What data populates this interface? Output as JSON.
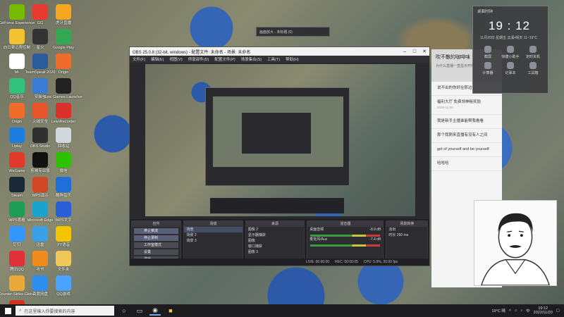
{
  "desktop_icons": [
    {
      "label": "GeForce Experience",
      "color": "#76b900"
    },
    {
      "label": "GG",
      "color": "#e83a2e"
    },
    {
      "label": "虎牙直播",
      "color": "#f5a623"
    },
    {
      "label": "向日葵远程控制",
      "color": "#f2c230"
    },
    {
      "label": "星火",
      "color": "#333333"
    },
    {
      "label": "Google Play",
      "color": "#34a853"
    },
    {
      "label": "Mr",
      "color": "#ffffff"
    },
    {
      "label": "TeamSpeak 2020",
      "color": "#2b5b9c"
    },
    {
      "label": "Origin",
      "color": "#f06c2a"
    },
    {
      "label": "QQ音乐",
      "color": "#31c27c"
    },
    {
      "label": "安装包",
      "color": "#3a7bd5"
    },
    {
      "label": "Epic Games Launcher",
      "color": "#222222"
    },
    {
      "label": "Origin",
      "color": "#f06c2a"
    },
    {
      "label": "火绒安全",
      "color": "#e8552a"
    },
    {
      "label": "LeanRecorder",
      "color": "#d9302a"
    },
    {
      "label": "Uplay",
      "color": "#1f7ce0"
    },
    {
      "label": "OBS Studio",
      "color": "#303030"
    },
    {
      "label": "回收站",
      "color": "#cfd8dc"
    },
    {
      "label": "WeGame",
      "color": "#e03b2a"
    },
    {
      "label": "剪映专业版",
      "color": "#111111"
    },
    {
      "label": "微信",
      "color": "#2dc100"
    },
    {
      "label": "Steam",
      "color": "#1b2838"
    },
    {
      "label": "WPS演示",
      "color": "#d24726"
    },
    {
      "label": "酷狗音乐",
      "color": "#1e6fd9"
    },
    {
      "label": "WPS表格",
      "color": "#1f9d55"
    },
    {
      "label": "Microsoft Edge",
      "color": "#1aa3cf"
    },
    {
      "label": "WPS文字",
      "color": "#2b5fd9"
    },
    {
      "label": "钉钉",
      "color": "#3296fa"
    },
    {
      "label": "迅雷",
      "color": "#3aa0e8"
    },
    {
      "label": "YY语音",
      "color": "#f5c400"
    },
    {
      "label": "腾讯QQ",
      "color": "#e0303a"
    },
    {
      "label": "听书",
      "color": "#f08c1e"
    },
    {
      "label": "文件夹",
      "color": "#f2c75a"
    },
    {
      "label": "Counter-Strike Global",
      "color": "#e8a93a"
    },
    {
      "label": "百度网盘",
      "color": "#2f8ff0"
    },
    {
      "label": "QQ游戏",
      "color": "#4aa3ff"
    },
    {
      "label": "网易云音乐",
      "color": "#d4301e"
    }
  ],
  "obs": {
    "title": "OBS 25.0.8 (32-bit, windows) - 配置文件: 未命名 - 场景: 未命名",
    "menu": [
      "文件(F)",
      "编辑(E)",
      "视图(V)",
      "停靠部件(D)",
      "配置文件(P)",
      "场景集合(S)",
      "工具(T)",
      "帮助(H)"
    ],
    "docks": {
      "controls_title": "控件",
      "controls": [
        "停止推流",
        "停止录制",
        "工作室模式",
        "设置",
        "退出"
      ],
      "scenes_title": "场景",
      "scenes": [
        "场景",
        "场景 2",
        "场景 3"
      ],
      "sources_title": "来源",
      "sources": [
        "图像 2",
        "显示器捕获",
        "图像",
        "窗口捕获",
        "图像 3"
      ],
      "mixer_title": "混音器",
      "mixer": [
        {
          "name": "桌面音频",
          "db": "-8.9 dB"
        },
        {
          "name": "麦克风/Aux",
          "db": "-7.4 dB"
        }
      ],
      "transition_title": "场景转换",
      "transition_type": "淡出",
      "duration_label": "时长",
      "duration_value": "250 ms"
    },
    "status": {
      "live": "LIVE: 00:00:00",
      "rec": "REC: 00:00:05",
      "cpu": "CPU: 5.9%, 30.00 fps"
    }
  },
  "small_window": {
    "label": "画面放大 - 未标题 (0)"
  },
  "clock_panel": {
    "title": "桌面时钟",
    "time": "19 : 12",
    "date": "11月20日  星期五        云溪•晴天 11~19°C",
    "tiles": [
      "截屏",
      "快捷小助手",
      "定时关机",
      "计算器",
      "记事本",
      "工具箱"
    ]
  },
  "chat": {
    "header": "吹不散的咖啡味",
    "subheader": "为什么直播一直显示开播",
    "messages": [
      {
        "text": "说不出的你好在那边",
        "meta": ""
      },
      {
        "text": "福利大厅 免费领神秘奖励",
        "meta": "2020-11-20"
      },
      {
        "text": "我是新手主播谁能帮我看看",
        "meta": ""
      },
      {
        "text": "那个我刚来直播有没有人之间",
        "meta": ""
      },
      {
        "text": "get of yourself and be yourself",
        "meta": ""
      },
      {
        "text": "哈哈哈",
        "meta": ""
      }
    ]
  },
  "taskbar": {
    "search_placeholder": "在这里输入你要搜索的内容",
    "weather": "19°C 晴",
    "tray_lang": "中",
    "time": "19:12",
    "date": "2022/11/20"
  }
}
